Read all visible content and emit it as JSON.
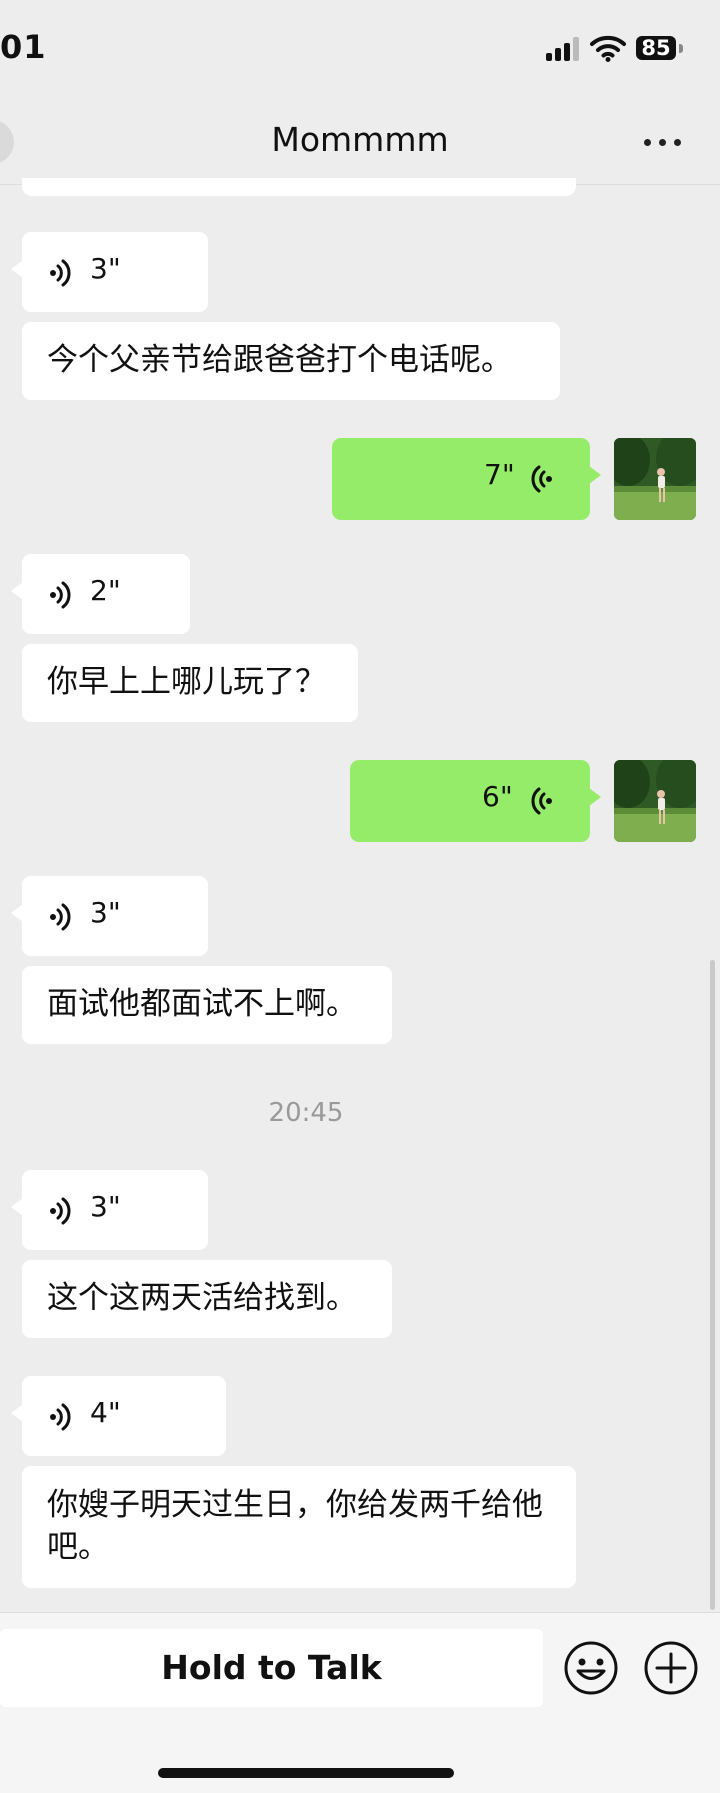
{
  "status_bar": {
    "time": "01",
    "battery": "85"
  },
  "header": {
    "title": "Mommmm"
  },
  "messages": [
    {
      "side": "left",
      "kind": "voice",
      "duration": "3\""
    },
    {
      "side": "left",
      "kind": "text",
      "text": "今个父亲节给跟爸爸打个电话呢。"
    },
    {
      "side": "right",
      "kind": "voice",
      "duration": "7\""
    },
    {
      "side": "left",
      "kind": "voice",
      "duration": "2\""
    },
    {
      "side": "left",
      "kind": "text",
      "text": "你早上上哪儿玩了？"
    },
    {
      "side": "right",
      "kind": "voice",
      "duration": "6\""
    },
    {
      "side": "left",
      "kind": "voice",
      "duration": "3\""
    },
    {
      "side": "left",
      "kind": "text",
      "text": "面试他都面试不上啊。"
    },
    {
      "kind": "timestamp",
      "text": "20:45"
    },
    {
      "side": "left",
      "kind": "voice",
      "duration": "3\""
    },
    {
      "side": "left",
      "kind": "text",
      "text": "这个这两天活给找到。"
    },
    {
      "side": "left",
      "kind": "voice",
      "duration": "4\""
    },
    {
      "side": "left",
      "kind": "text",
      "text": "你嫂子明天过生日，你给发两千给他吧。"
    }
  ],
  "input_bar": {
    "hold_to_talk_label": "Hold to Talk"
  },
  "icons": {
    "voice_incoming": "voice-wave-icon",
    "voice_outgoing": "voice-wave-icon",
    "emoji": "smiley-face-icon",
    "plus": "plus-circle-icon",
    "more": "more-dots-icon"
  },
  "colors": {
    "background": "#ededed",
    "outgoing_bubble": "#95ec69",
    "incoming_bubble": "#ffffff",
    "timestamp": "#999999"
  }
}
